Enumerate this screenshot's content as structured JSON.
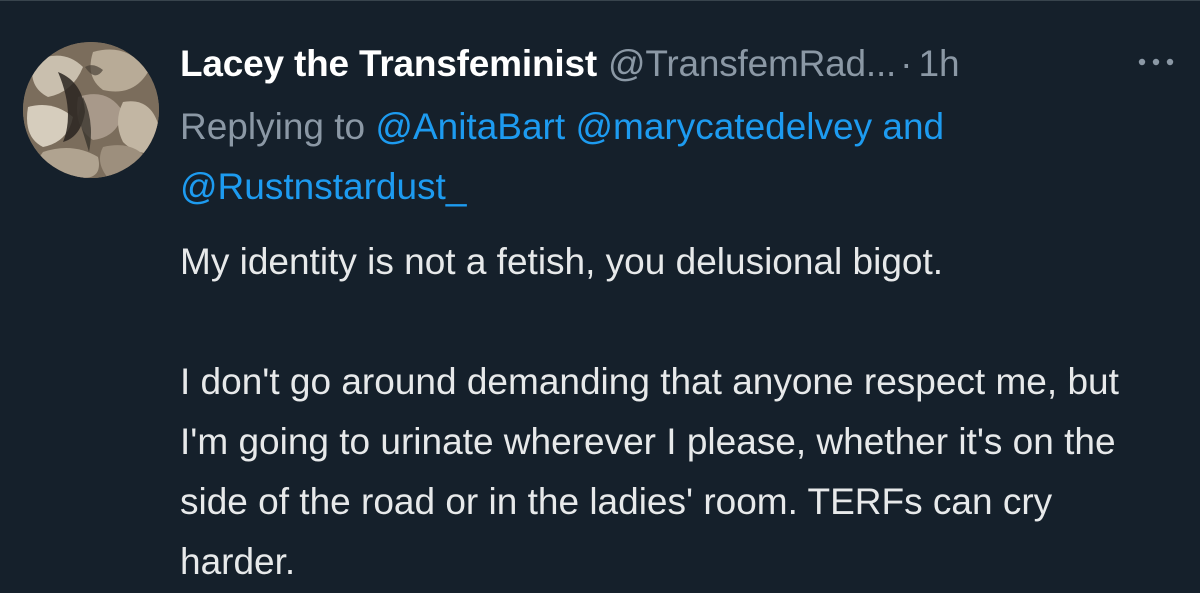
{
  "tweet": {
    "display_name": "Lacey the Transfeminist",
    "handle": "@TransfemRad...",
    "separator": "·",
    "time": "1h",
    "more_icon": "more-horizontal-icon",
    "replying_to_prefix": "Replying to",
    "mentions": [
      "@AnitaBart",
      "@marycatedelvey",
      "@Rustnstardust_"
    ],
    "mention_conjunction": "and",
    "paragraphs": [
      "My identity is not a fetish, you delusional bigot.",
      "I don't go around demanding that anyone respect me, but I'm going to urinate wherever I please, whether it's on the side of the road or in the ladies' room. TERFs can cry harder."
    ]
  },
  "colors": {
    "background": "#15202b",
    "primary_text": "#e7e9ea",
    "secondary_text": "#8b98a5",
    "link": "#1d9bf0"
  }
}
